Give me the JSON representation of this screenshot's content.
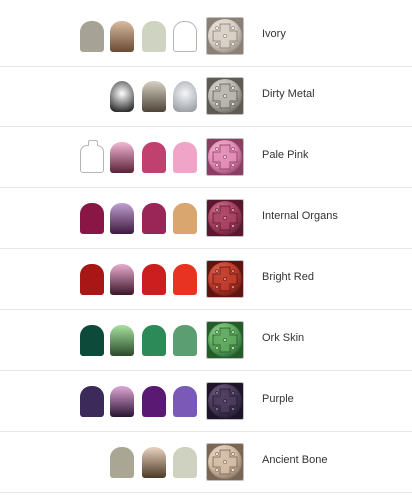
{
  "rows": [
    {
      "name": "Ivory",
      "thumb": {
        "light": "#f2ece4",
        "base": "#d9d0c6",
        "dark": "#8a8078"
      },
      "pots": [
        {
          "slot": 1,
          "kind": "solid",
          "color": "#a6a396"
        },
        {
          "slot": 2,
          "kind": "gradient",
          "top": "#d9bba1",
          "bottom": "#6a4a34"
        },
        {
          "slot": 3,
          "kind": "solid",
          "color": "#cfd3c2"
        },
        {
          "slot": 4,
          "kind": "outline"
        }
      ]
    },
    {
      "name": "Dirty Metal",
      "thumb": {
        "light": "#e8e6e2",
        "base": "#b8b4ae",
        "dark": "#5f5a54"
      },
      "pots": [
        {
          "slot": 2,
          "kind": "metal",
          "top": "#ffffff",
          "bottom": "#2e2e2e"
        },
        {
          "slot": 3,
          "kind": "gradient",
          "top": "#d8d0c4",
          "bottom": "#4e4438"
        },
        {
          "slot": 4,
          "kind": "metal",
          "top": "#f4f6f8",
          "bottom": "#9ea2a8"
        }
      ]
    },
    {
      "name": "Pale Pink",
      "thumb": {
        "light": "#f6c2da",
        "base": "#e28cb6",
        "dark": "#8a3e62"
      },
      "pots": [
        {
          "slot": 1,
          "kind": "spray"
        },
        {
          "slot": 2,
          "kind": "gradient",
          "top": "#f3b8d6",
          "bottom": "#5a2236"
        },
        {
          "slot": 3,
          "kind": "solid",
          "color": "#c0406e"
        },
        {
          "slot": 4,
          "kind": "solid",
          "color": "#f0a4c8"
        }
      ]
    },
    {
      "name": "Internal Organs",
      "thumb": {
        "light": "#e08aa4",
        "base": "#a84262",
        "dark": "#5a1830"
      },
      "pots": [
        {
          "slot": 1,
          "kind": "solid",
          "color": "#8a1646"
        },
        {
          "slot": 2,
          "kind": "gradient",
          "top": "#c0a0d0",
          "bottom": "#3e1a40"
        },
        {
          "slot": 3,
          "kind": "solid",
          "color": "#9a2658"
        },
        {
          "slot": 4,
          "kind": "solid",
          "color": "#d8a66e"
        }
      ]
    },
    {
      "name": "Bright Red",
      "thumb": {
        "light": "#e87a62",
        "base": "#c03c2c",
        "dark": "#5e1410"
      },
      "pots": [
        {
          "slot": 1,
          "kind": "solid",
          "color": "#a81616"
        },
        {
          "slot": 2,
          "kind": "gradient",
          "top": "#e8aed0",
          "bottom": "#3c1628"
        },
        {
          "slot": 3,
          "kind": "solid",
          "color": "#cc1e1e"
        },
        {
          "slot": 4,
          "kind": "solid",
          "color": "#e83222"
        }
      ]
    },
    {
      "name": "Ork Skin",
      "thumb": {
        "light": "#a8e0a0",
        "base": "#5ea85e",
        "dark": "#245c2c"
      },
      "pots": [
        {
          "slot": 1,
          "kind": "solid",
          "color": "#0e4a3a"
        },
        {
          "slot": 2,
          "kind": "gradient",
          "top": "#a8e2a0",
          "bottom": "#2a4a2a"
        },
        {
          "slot": 3,
          "kind": "solid",
          "color": "#2c8a58"
        },
        {
          "slot": 4,
          "kind": "solid",
          "color": "#5a9e72"
        }
      ]
    },
    {
      "name": "Purple",
      "thumb": {
        "light": "#7a6a8e",
        "base": "#4a3a5c",
        "dark": "#1e1628"
      },
      "pots": [
        {
          "slot": 1,
          "kind": "solid",
          "color": "#3c2a5a"
        },
        {
          "slot": 2,
          "kind": "gradient",
          "top": "#e0a8d6",
          "bottom": "#2a1434"
        },
        {
          "slot": 3,
          "kind": "solid",
          "color": "#5a1a74"
        },
        {
          "slot": 4,
          "kind": "solid",
          "color": "#7a5ab6"
        }
      ]
    },
    {
      "name": "Ancient Bone",
      "thumb": {
        "light": "#f2e0d0",
        "base": "#d2bca6",
        "dark": "#7a6654"
      },
      "pots": [
        {
          "slot": 2,
          "kind": "solid",
          "color": "#aaa694"
        },
        {
          "slot": 3,
          "kind": "gradient",
          "top": "#e8d4c0",
          "bottom": "#4e3826"
        },
        {
          "slot": 4,
          "kind": "solid",
          "color": "#cfd2c0"
        }
      ]
    }
  ]
}
